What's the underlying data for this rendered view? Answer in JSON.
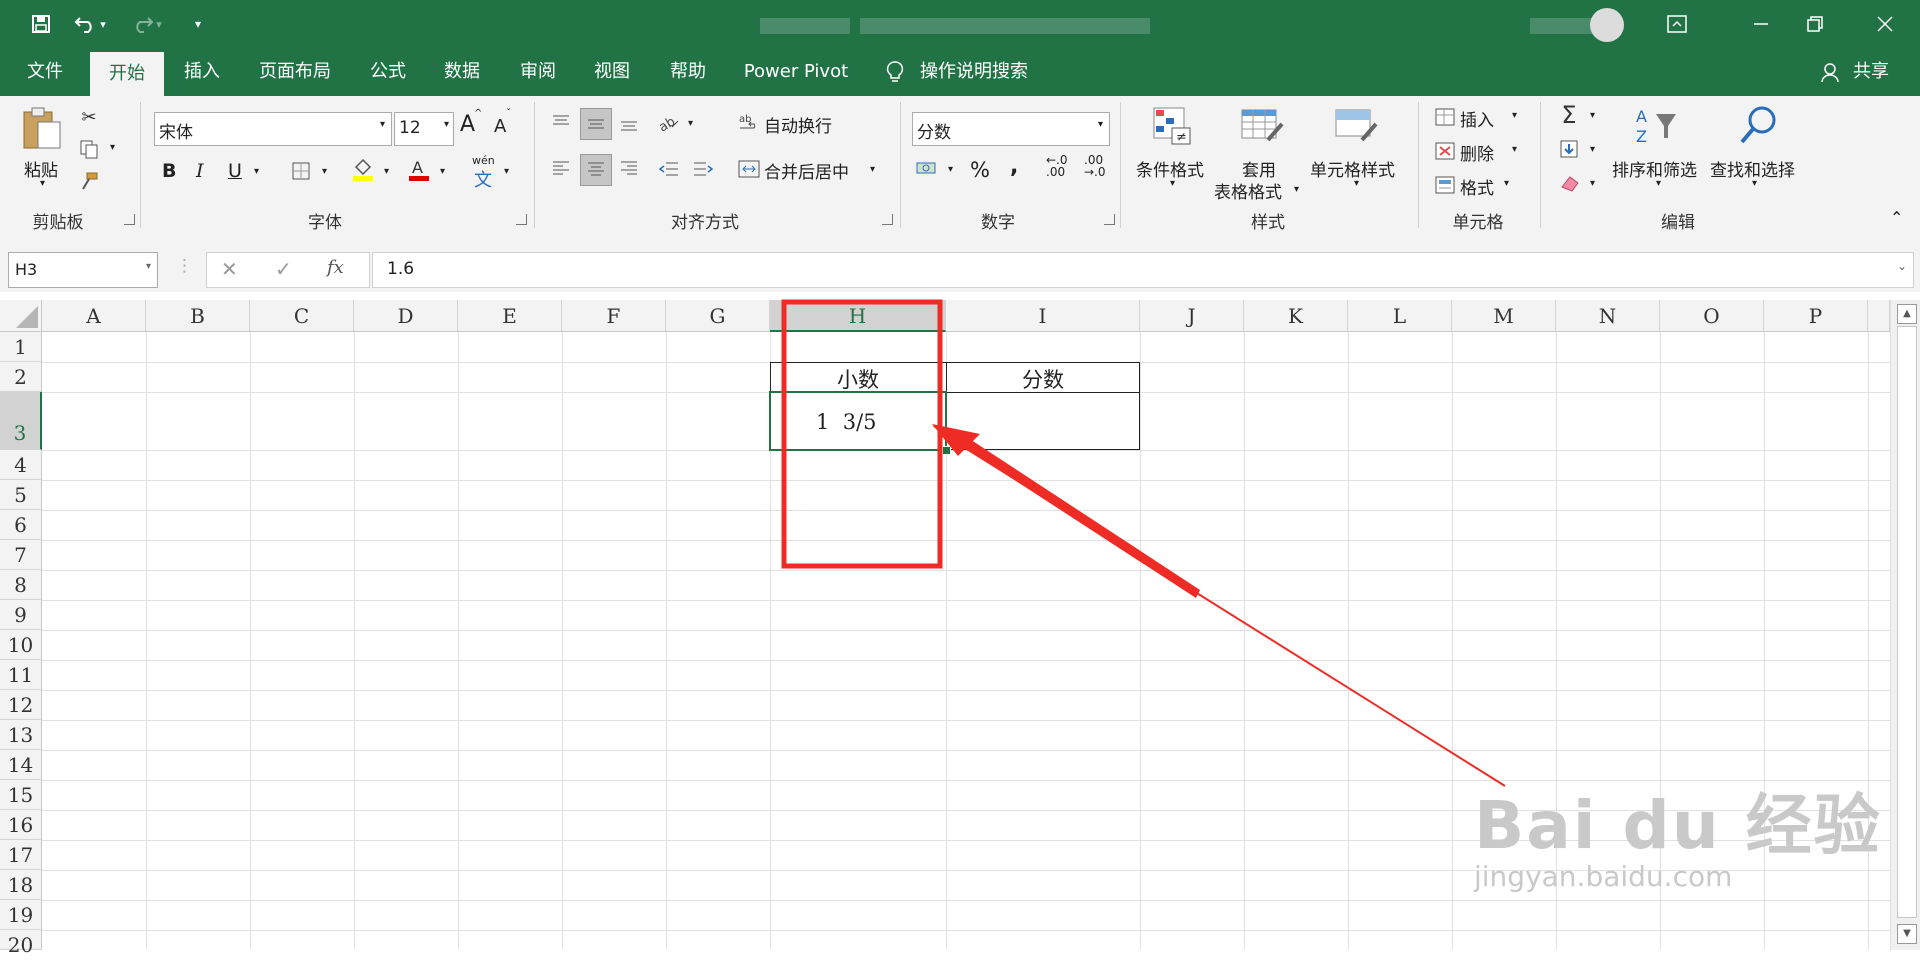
{
  "title_bar": {
    "share_label": "共享"
  },
  "ribbon_tabs": [
    "文件",
    "开始",
    "插入",
    "页面布局",
    "公式",
    "数据",
    "审阅",
    "视图",
    "帮助",
    "Power Pivot",
    "操作说明搜索"
  ],
  "clipboard": {
    "paste_label": "粘贴",
    "group_label": "剪贴板"
  },
  "font": {
    "name": "宋体",
    "size": "12",
    "group_label": "字体",
    "bold": "B",
    "italic": "I",
    "underline": "U",
    "grow": "A",
    "shrink": "A",
    "phonetic_top": "wén",
    "phonetic_bottom": "文"
  },
  "alignment": {
    "wrap_label": "自动换行",
    "merge_label": "合并后居中",
    "group_label": "对齐方式"
  },
  "number": {
    "format": "分数",
    "percent": "%",
    "comma": ",",
    "inc_dec_top": "←.0",
    "inc_dec_bottom": ".00",
    "dec_dec_top": ".00",
    "dec_dec_bottom": "→.0",
    "group_label": "数字"
  },
  "styles": {
    "conditional": "条件格式",
    "table_top": "套用",
    "table_bottom": "表格格式",
    "cell_styles": "单元格样式",
    "group_label": "样式"
  },
  "cells": {
    "insert": "插入",
    "delete": "删除",
    "format": "格式",
    "group_label": "单元格"
  },
  "editing": {
    "sort_filter": "排序和筛选",
    "find_select": "查找和选择",
    "group_label": "编辑"
  },
  "formula_bar": {
    "name_box": "H3",
    "fx": "fx",
    "value": "1.6"
  },
  "columns": [
    "A",
    "B",
    "C",
    "D",
    "E",
    "F",
    "G",
    "H",
    "I",
    "J",
    "K",
    "L",
    "M",
    "N",
    "O",
    "P"
  ],
  "rows": [
    "1",
    "2",
    "3",
    "4",
    "5",
    "6",
    "7",
    "8",
    "9",
    "10",
    "11",
    "12",
    "13",
    "14",
    "15",
    "16",
    "17",
    "18",
    "19",
    "20"
  ],
  "cells_data": {
    "h2": "小数",
    "i2": "分数",
    "h3": "1  3/5"
  },
  "watermark": {
    "brand": "Bai du 经验",
    "url": "jingyan.baidu.com"
  },
  "colors": {
    "accent": "#217346",
    "annotation": "#ee2b24"
  }
}
